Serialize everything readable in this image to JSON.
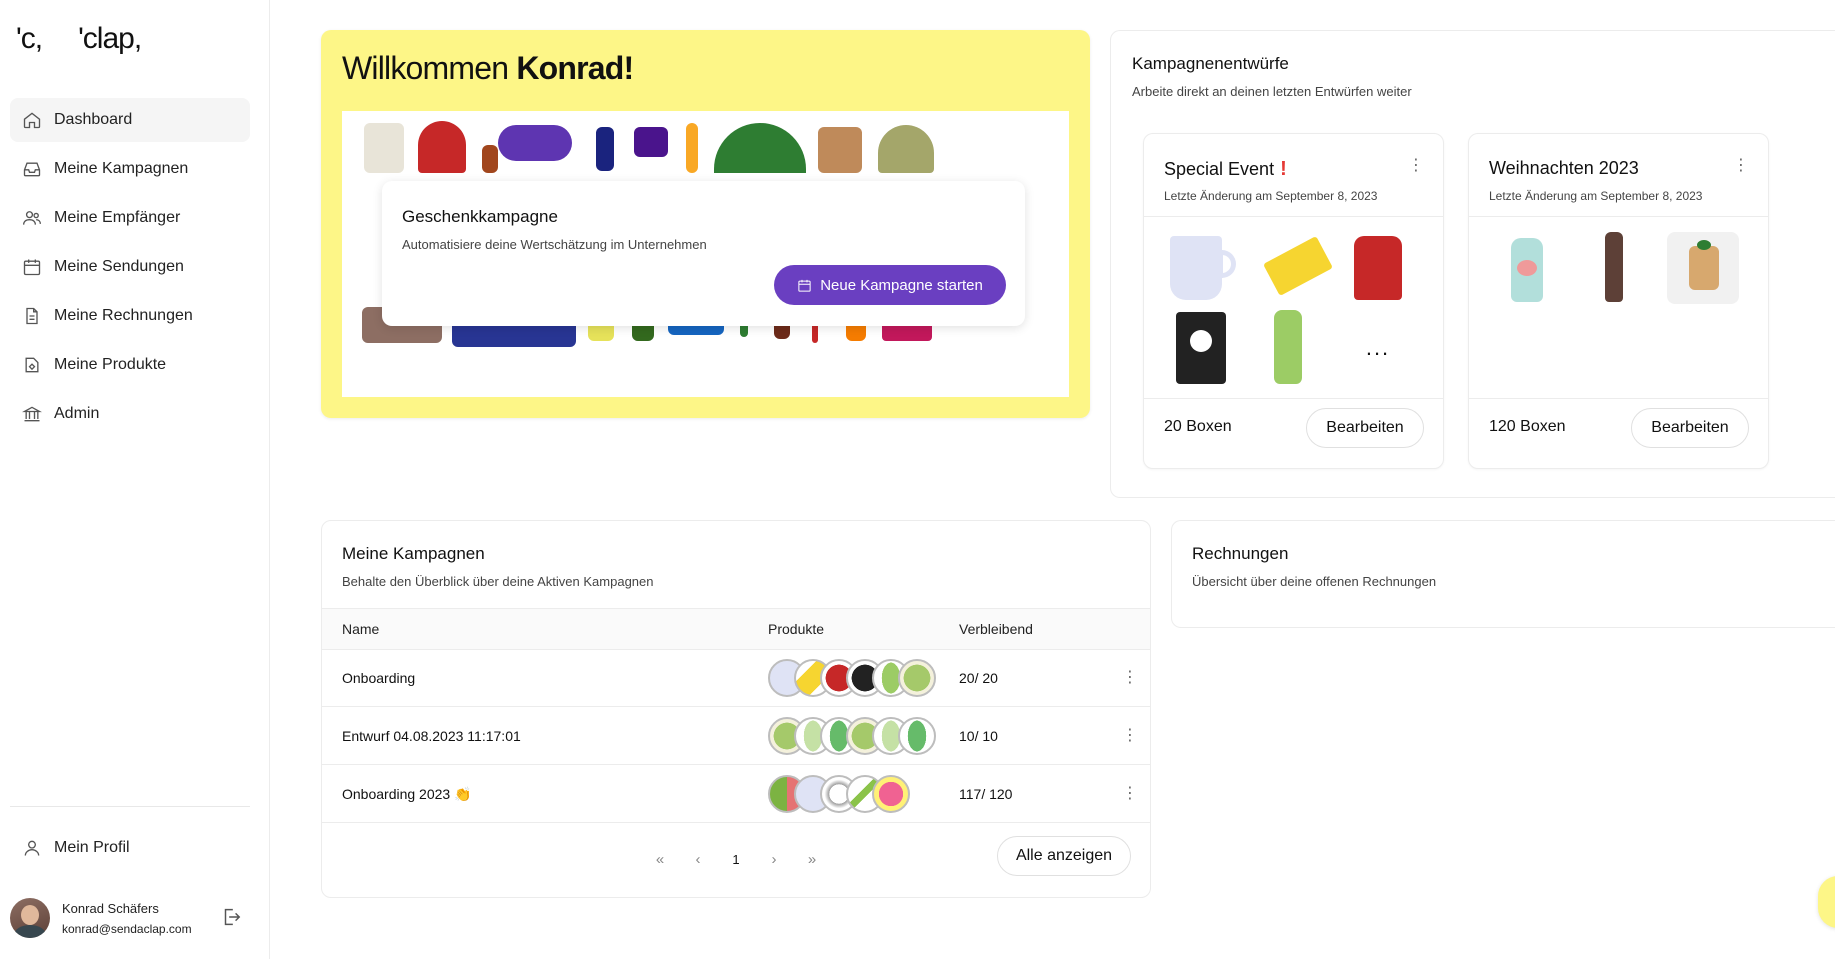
{
  "brand": {
    "logo_mark": "'c,",
    "logo_text": "'clap,"
  },
  "sidebar": {
    "items": [
      {
        "label": "Dashboard",
        "icon": "home-icon",
        "active": true
      },
      {
        "label": "Meine Kampagnen",
        "icon": "inbox-icon"
      },
      {
        "label": "Meine Empfänger",
        "icon": "users-icon"
      },
      {
        "label": "Meine Sendungen",
        "icon": "calendar-icon"
      },
      {
        "label": "Meine Rechnungen",
        "icon": "document-icon"
      },
      {
        "label": "Meine Produkte",
        "icon": "products-icon"
      },
      {
        "label": "Admin",
        "icon": "bank-icon"
      }
    ],
    "profile_label": "Mein Profil",
    "user": {
      "name": "Konrad Schäfers",
      "email": "konrad@sendaclap.com"
    }
  },
  "welcome": {
    "greeting": "Willkommen",
    "name": "Konrad!",
    "gift_title": "Geschenkkampagne",
    "gift_subtitle": "Automatisiere deine Wertschätzung im Unternehmen",
    "cta_label": "Neue Kampagne starten"
  },
  "drafts": {
    "title": "Kampagnenentwürfe",
    "subtitle": "Arbeite direkt an deinen letzten Entwürfen weiter",
    "cards": [
      {
        "title": "Special Event",
        "urgent_mark": "!",
        "date": "Letzte Änderung am September 8, 2023",
        "count": "20 Boxen",
        "edit_label": "Bearbeiten",
        "more": "..."
      },
      {
        "title": "Weihnachten 2023",
        "date": "Letzte Änderung am September 8, 2023",
        "count": "120 Boxen",
        "edit_label": "Bearbeiten"
      }
    ]
  },
  "campaigns": {
    "title": "Meine Kampagnen",
    "subtitle": "Behalte den Überblick über deine Aktiven Kampagnen",
    "columns": {
      "name": "Name",
      "products": "Produkte",
      "remaining": "Verbleibend"
    },
    "rows": [
      {
        "name": "Onboarding",
        "remaining": "20/ 20"
      },
      {
        "name": "Entwurf 04.08.2023 11:17:01",
        "remaining": "10/ 10"
      },
      {
        "name": "Onboarding 2023",
        "emoji": "👏",
        "remaining": "117/ 120"
      }
    ],
    "pager": {
      "first": "«",
      "prev": "‹",
      "page": "1",
      "next": "›",
      "last": "»"
    },
    "show_all_label": "Alle anzeigen"
  },
  "invoices": {
    "title": "Rechnungen",
    "subtitle": "Übersicht über deine offenen Rechnungen"
  },
  "colors": {
    "accent": "#6a3fc1",
    "welcome_bg": "#fdf687",
    "urgent": "#e53935"
  }
}
